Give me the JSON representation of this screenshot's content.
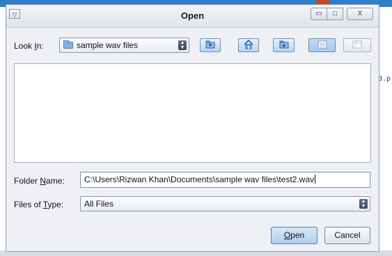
{
  "dialog": {
    "title": "Open",
    "window_controls": {
      "sysmenu_glyph": "▽",
      "minimize_glyph": "▭",
      "maximize_glyph": "□",
      "close_glyph": "X"
    }
  },
  "look_in": {
    "label_pre": "Look ",
    "label_mnemonic": "I",
    "label_post": "n:",
    "value": "sample wav files"
  },
  "toolbar": {
    "icons": [
      "up-folder-icon",
      "home-icon",
      "new-folder-icon",
      "list-view-icon",
      "details-view-icon"
    ],
    "accent": "#2467b0"
  },
  "folder_name": {
    "label_pre": "Folder ",
    "label_mnemonic": "N",
    "label_post": "ame:",
    "value": "C:\\Users\\Rizwan Khan\\Documents\\sample wav files\\test2.wav"
  },
  "files_of_type": {
    "label_pre": "Files of ",
    "label_mnemonic": "T",
    "label_post": "ype:",
    "value": "All Files"
  },
  "buttons": {
    "open_mnemonic": "O",
    "open_rest": "pen",
    "cancel": "Cancel"
  },
  "background": {
    "side_text": "d.p"
  }
}
